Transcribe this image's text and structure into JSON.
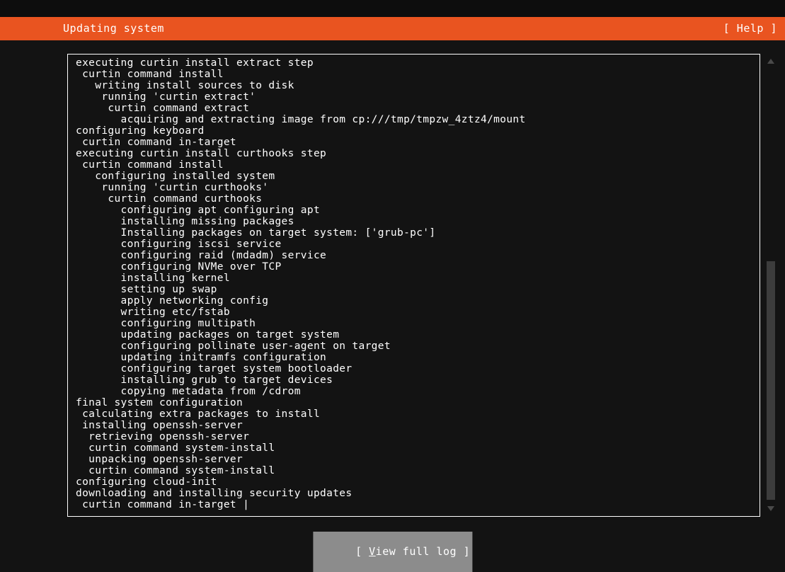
{
  "header": {
    "title": "Updating system",
    "help_label": "[ Help ]"
  },
  "log": {
    "lines": [
      "executing curtin install extract step",
      " curtin command install",
      "   writing install sources to disk",
      "    running 'curtin extract'",
      "     curtin command extract",
      "       acquiring and extracting image from cp:///tmp/tmpzw_4ztz4/mount",
      "configuring keyboard",
      " curtin command in-target",
      "executing curtin install curthooks step",
      " curtin command install",
      "   configuring installed system",
      "    running 'curtin curthooks'",
      "     curtin command curthooks",
      "       configuring apt configuring apt",
      "       installing missing packages",
      "       Installing packages on target system: ['grub-pc']",
      "       configuring iscsi service",
      "       configuring raid (mdadm) service",
      "       configuring NVMe over TCP",
      "       installing kernel",
      "       setting up swap",
      "       apply networking config",
      "       writing etc/fstab",
      "       configuring multipath",
      "       updating packages on target system",
      "       configuring pollinate user-agent on target",
      "       updating initramfs configuration",
      "       configuring target system bootloader",
      "       installing grub to target devices",
      "       copying metadata from /cdrom",
      "final system configuration",
      " calculating extra packages to install",
      " installing openssh-server",
      "  retrieving openssh-server",
      "  curtin command system-install",
      "  unpacking openssh-server",
      "  curtin command system-install",
      "configuring cloud-init",
      "downloading and installing security updates",
      " curtin command in-target "
    ],
    "cursor": "|"
  },
  "scrollbar": {
    "up_icon": "triangle-up-icon",
    "down_icon": "triangle-down-icon",
    "thumb_color": "#3c3c3c"
  },
  "footer": {
    "view_full_log": {
      "prefix": "[ ",
      "accel": "V",
      "rest": "iew full log",
      "suffix": " ]"
    }
  },
  "colors": {
    "accent": "#e95420",
    "background": "#131313",
    "text": "#ffffff",
    "button_selected_bg": "#8c8c8c"
  }
}
